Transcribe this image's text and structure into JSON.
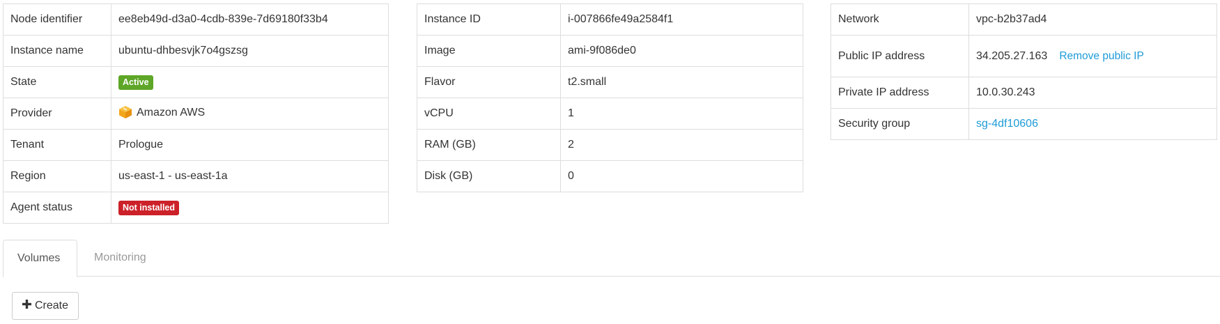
{
  "node_table": {
    "rows": [
      {
        "label": "Node identifier",
        "value": "ee8eb49d-d3a0-4cdb-839e-7d69180f33b4"
      },
      {
        "label": "Instance name",
        "value": "ubuntu-dhbesvjk7o4gszsg"
      },
      {
        "label": "State",
        "badge": "Active"
      },
      {
        "label": "Provider",
        "value": "Amazon AWS",
        "icon": "aws-cube-icon"
      },
      {
        "label": "Tenant",
        "value": "Prologue"
      },
      {
        "label": "Region",
        "value": "us-east-1 - us-east-1a"
      },
      {
        "label": "Agent status",
        "badge": "Not installed"
      }
    ]
  },
  "instance_table": {
    "rows": [
      {
        "label": "Instance ID",
        "value": "i-007866fe49a2584f1"
      },
      {
        "label": "Image",
        "value": "ami-9f086de0"
      },
      {
        "label": "Flavor",
        "value": "t2.small"
      },
      {
        "label": "vCPU",
        "value": "1"
      },
      {
        "label": "RAM (GB)",
        "value": "2"
      },
      {
        "label": "Disk (GB)",
        "value": "0"
      }
    ]
  },
  "network_table": {
    "rows": [
      {
        "label": "Network",
        "value": "vpc-b2b37ad4"
      },
      {
        "label": "Public IP address",
        "value": "34.205.27.163",
        "action": "Remove public IP"
      },
      {
        "label": "Private IP address",
        "value": "10.0.30.243"
      },
      {
        "label": "Security group",
        "value": "sg-4df10606"
      }
    ]
  },
  "tabs": [
    {
      "label": "Volumes",
      "active": true
    },
    {
      "label": "Monitoring",
      "active": false
    }
  ],
  "create_button": {
    "label": "Create",
    "icon": "plus-icon"
  },
  "colors": {
    "active_badge": "#5ea627",
    "danger_badge": "#cc2129",
    "link": "#1e9bd7",
    "border": "#dddddd"
  }
}
